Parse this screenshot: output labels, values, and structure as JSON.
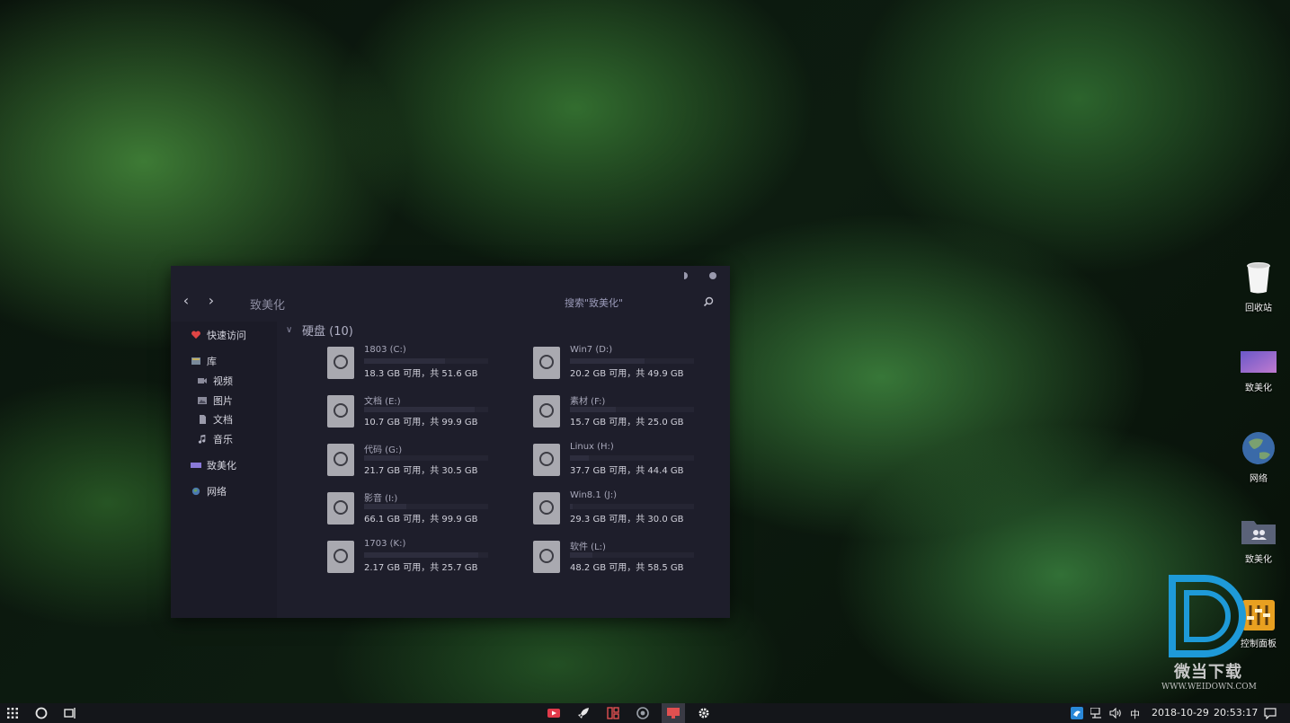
{
  "explorer": {
    "address": "致美化",
    "search_placeholder": "搜索\"致美化\"",
    "nav": {
      "back": "‹",
      "forward": "›"
    },
    "sidebar": {
      "quick_access": "快速访问",
      "library": "库",
      "videos": "视频",
      "pictures": "图片",
      "documents": "文档",
      "music": "音乐",
      "zhimeihua": "致美化",
      "network": "网络"
    },
    "group_title": "硬盘 (10)",
    "drives": [
      {
        "name": "1803 (C:)",
        "free_text": "18.3 GB 可用，共 51.6 GB",
        "used_fraction": 0.65
      },
      {
        "name": "Win7 (D:)",
        "free_text": "20.2 GB 可用，共 49.9 GB",
        "used_fraction": 0.6
      },
      {
        "name": "文档 (E:)",
        "free_text": "10.7 GB 可用，共 99.9 GB",
        "used_fraction": 0.89
      },
      {
        "name": "素材 (F:)",
        "free_text": "15.7 GB 可用，共 25.0 GB",
        "used_fraction": 0.37
      },
      {
        "name": "代码 (G:)",
        "free_text": "21.7 GB 可用，共 30.5 GB",
        "used_fraction": 0.29
      },
      {
        "name": "Linux (H:)",
        "free_text": "37.7 GB 可用，共 44.4 GB",
        "used_fraction": 0.15
      },
      {
        "name": "影音 (I:)",
        "free_text": "66.1 GB 可用，共 99.9 GB",
        "used_fraction": 0.34
      },
      {
        "name": "Win8.1 (J:)",
        "free_text": "29.3 GB 可用，共 30.0 GB",
        "used_fraction": 0.02
      },
      {
        "name": "1703 (K:)",
        "free_text": "2.17 GB 可用，共 25.7 GB",
        "used_fraction": 0.92
      },
      {
        "name": "软件 (L:)",
        "free_text": "48.2 GB 可用，共 58.5 GB",
        "used_fraction": 0.18
      }
    ]
  },
  "desktop": {
    "recycle_bin": "回收站",
    "zhimeihua": "致美化",
    "network": "网络",
    "zhimeihua_folder": "致美化",
    "control_panel": "控制面板"
  },
  "watermark": {
    "brand": "微当下载",
    "url": "WWW.WEIDOWN.COM"
  },
  "taskbar": {
    "ime": "中",
    "date": "2018-10-29",
    "time": "20:53:17"
  },
  "colors": {
    "window_bg": "#1e1e2b",
    "sidebar_bg": "#1b1b27",
    "accent": "#8a7ad8",
    "taskbar_bg": "#14161a"
  }
}
